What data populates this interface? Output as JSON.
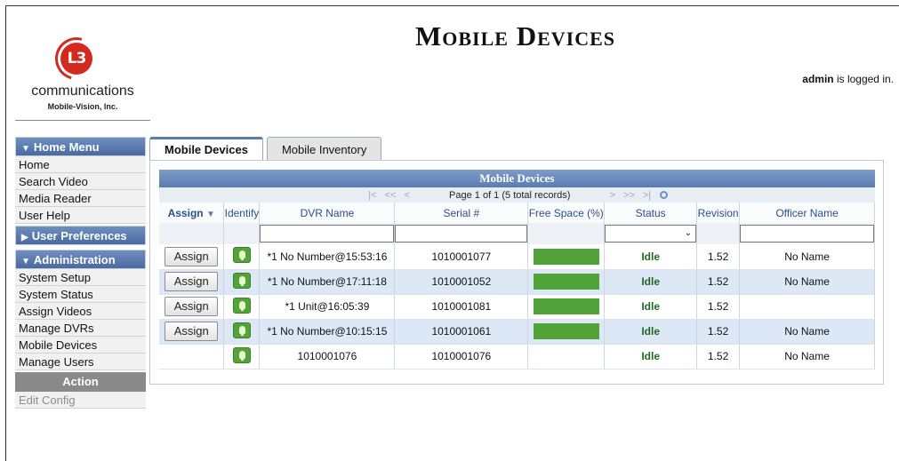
{
  "header": {
    "title": "Mobile Devices",
    "login_user": "admin",
    "login_suffix": " is logged in."
  },
  "logo": {
    "mark": "L3",
    "name": "communications",
    "sub": "Mobile-Vision, Inc.",
    "color": "#d22a1f"
  },
  "sidebar": {
    "home_menu": "Home Menu",
    "home_items": [
      "Home",
      "Search Video",
      "Media Reader",
      "User Help"
    ],
    "user_prefs": "User Preferences",
    "administration": "Administration",
    "admin_items": [
      "System Setup",
      "System Status",
      "Assign Videos",
      "Manage DVRs",
      "Mobile Devices",
      "Manage Users"
    ],
    "action": "Action",
    "action_items": [
      "Edit Config"
    ]
  },
  "tabs": [
    "Mobile Devices",
    "Mobile Inventory"
  ],
  "grid": {
    "title": "Mobile Devices",
    "pager": "Page 1 of 1 (5 total records)",
    "columns": [
      "Assign",
      "Identify",
      "DVR Name",
      "Serial #",
      "Free Space (%)",
      "Status",
      "Revision",
      "Officer Name"
    ],
    "assign_label": "Assign",
    "rows": [
      {
        "dvr": "*1 No Number@15:53:16",
        "serial": "1010001077",
        "status": "Idle",
        "revision": "1.52",
        "officer": "No Name",
        "has_assign": true
      },
      {
        "dvr": "*1 No Number@17:11:18",
        "serial": "1010001052",
        "status": "Idle",
        "revision": "1.52",
        "officer": "No Name",
        "has_assign": true
      },
      {
        "dvr": "*1 Unit@16:05:39",
        "serial": "1010001081",
        "status": "Idle",
        "revision": "1.52",
        "officer": "",
        "has_assign": true
      },
      {
        "dvr": "*1 No Number@10:15:15",
        "serial": "1010001061",
        "status": "Idle",
        "revision": "1.52",
        "officer": "No Name",
        "has_assign": true
      },
      {
        "dvr": "1010001076",
        "serial": "1010001076",
        "status": "Idle",
        "revision": "1.52",
        "officer": "No Name",
        "has_assign": false
      }
    ]
  },
  "colors": {
    "header_blue": "#5a7cb0",
    "bar_green": "#53a33b",
    "idle_green": "#226a22",
    "row_alt": "#dde8f7"
  }
}
